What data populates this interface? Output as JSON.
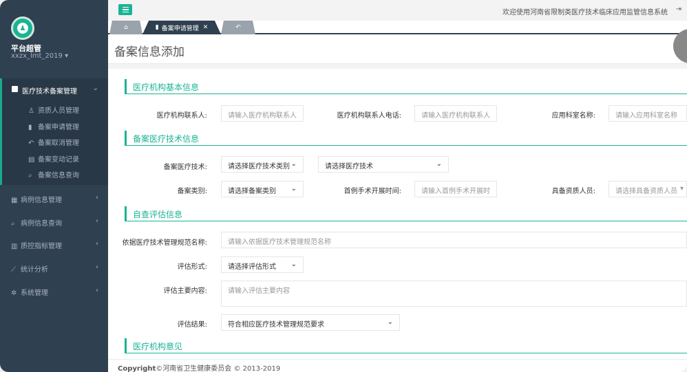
{
  "app": {
    "welcome": "欢迎使用河南省限制类医疗技术临床应用监管信息系统"
  },
  "user": {
    "name": "平台超管",
    "account": "xxzx_lmt_2019 ▾"
  },
  "sidebar": {
    "main_group": {
      "label": "医疗技术备案管理",
      "items": [
        {
          "icon": "person-icon",
          "label": "资质人员管理"
        },
        {
          "icon": "bookmark-icon",
          "label": "备案申请管理"
        },
        {
          "icon": "reply-icon",
          "label": "备案取消管理"
        },
        {
          "icon": "file-icon",
          "label": "备案变动记录"
        },
        {
          "icon": "search-icon",
          "label": "备案信息查询"
        }
      ]
    },
    "groups": [
      {
        "icon": "grid-icon",
        "label": "病例信息管理"
      },
      {
        "icon": "search-icon",
        "label": "病例信息查询"
      },
      {
        "icon": "bar-chart-icon",
        "label": "质控指标管理"
      },
      {
        "icon": "line-chart-icon",
        "label": "统计分析"
      },
      {
        "icon": "gear-icon",
        "label": "系统管理"
      }
    ]
  },
  "tabs": [
    {
      "icon": "home-icon",
      "label": ""
    },
    {
      "icon": "bookmark-icon",
      "label": "备案申请管理"
    },
    {
      "icon": "back-icon",
      "label": ""
    }
  ],
  "page": {
    "title": "备案信息添加"
  },
  "sections": {
    "basic": "医疗机构基本信息",
    "tech": "备案医疗技术信息",
    "self_eval": "自查评估信息",
    "opinion": "医疗机构意见"
  },
  "fields": {
    "contact": {
      "label": "医疗机构联系人:",
      "placeholder": "请输入医疗机构联系人"
    },
    "contact_phone": {
      "label": "医疗机构联系人电话:",
      "placeholder": "请输入医疗机构联系人"
    },
    "dept": {
      "label": "应用科室名称:",
      "placeholder": "请输入应用科室名称"
    },
    "tech": {
      "label": "备案医疗技术:",
      "type_value": "请选择医疗技术类别",
      "tech_value": "请选择医疗技术"
    },
    "record_type": {
      "label": "备案类别:",
      "value": "请选择备案类别"
    },
    "first_op": {
      "label": "首例手术开展时间:",
      "placeholder": "请输入首例手术开展时"
    },
    "staff": {
      "label": "具备资质人员:",
      "value": "请选择具备资质人员"
    },
    "norm_name": {
      "label": "依据医疗技术管理规范名称:",
      "placeholder": "请输入依据医疗技术管理规范名称"
    },
    "eval_form": {
      "label": "评估形式:",
      "value": "请选择评估形式"
    },
    "eval_content": {
      "label": "评估主要内容:",
      "placeholder": "请输入评估主要内容"
    },
    "eval_result": {
      "label": "评估结果:",
      "value": "符合相应医疗技术管理规范要求"
    }
  },
  "footer": {
    "brand": "Copyright",
    "text": "©河南省卫生健康委员会 © 2013-2019"
  },
  "colors": {
    "accent": "#1ab394",
    "sidebar": "#2f4050"
  }
}
